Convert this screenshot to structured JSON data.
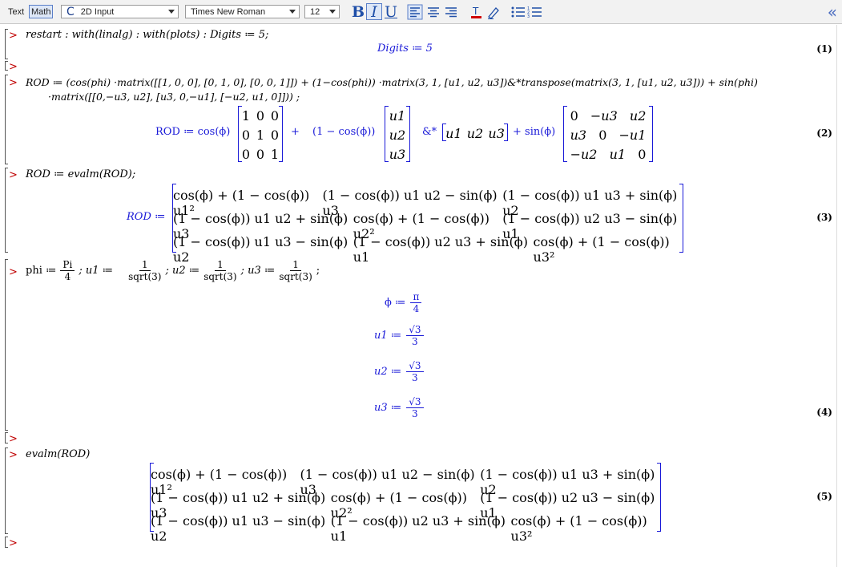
{
  "toolbar": {
    "text_mode": "Text",
    "math_mode": "Math",
    "input_mode": "2D Input",
    "font": "Times New Roman",
    "size": "12",
    "bold": "B",
    "italic": "I",
    "underline": "U"
  },
  "worksheet": {
    "in1": "restart : with(linalg) : with(plots) : Digits ≔ 5;",
    "out1": "Digits ≔ 5",
    "label1": "(1)",
    "in2_line1": "ROD ≔ (cos(phi) ·matrix([[1, 0, 0], [0, 1, 0], [0, 0, 1]]) + (1−cos(phi)) ·matrix(3, 1, [u1, u2, u3])&*transpose(matrix(3, 1, [u1, u2, u3])) + sin(phi)",
    "in2_line2": "·matrix([[0,−u3, u2], [u3, 0,−u1], [−u2, u1, 0]])) ;",
    "out2_lhs": "ROD ≔ cos(ϕ)",
    "out2_id": [
      [
        "1",
        "0",
        "0"
      ],
      [
        "0",
        "1",
        "0"
      ],
      [
        "0",
        "0",
        "1"
      ]
    ],
    "out2_plus1": "+",
    "out2_mid": "(1 − cos(ϕ))",
    "out2_u": [
      "u1",
      "u2",
      "u3"
    ],
    "out2_amp": "&*",
    "out2_ut": [
      "u1",
      "u2",
      "u3"
    ],
    "out2_plus2": "+ sin(ϕ)",
    "out2_skew": [
      [
        "0",
        "−u3",
        "u2"
      ],
      [
        "u3",
        "0",
        "−u1"
      ],
      [
        "−u2",
        "u1",
        "0"
      ]
    ],
    "label2": "(2)",
    "in3": "ROD ≔ evalm(ROD);",
    "out3_lhs": "ROD ≔",
    "rod_matrix": [
      [
        "cos(ϕ) + (1 − cos(ϕ)) u1²",
        "(1 − cos(ϕ)) u1 u2 − sin(ϕ) u3",
        "(1 − cos(ϕ)) u1 u3 + sin(ϕ) u2"
      ],
      [
        "(1 − cos(ϕ)) u1 u2 + sin(ϕ) u3",
        "cos(ϕ) + (1 − cos(ϕ)) u2²",
        "(1 − cos(ϕ)) u2 u3 − sin(ϕ) u1"
      ],
      [
        "(1 − cos(ϕ)) u1 u3 − sin(ϕ) u2",
        "(1 − cos(ϕ)) u2 u3 + sin(ϕ) u1",
        "cos(ϕ) + (1 − cos(ϕ)) u3²"
      ]
    ],
    "label3": "(3)",
    "in4_phi": "phi ≔",
    "in4_pi": "Pi",
    "in4_four": "4",
    "in4_u1": "; u1 ≔",
    "in4_u2": "; u2 ≔",
    "in4_u3": "; u3 ≔",
    "in4_one": "1",
    "in4_sqrt": "sqrt(3)",
    "in4_end": ";",
    "out4_phi": "ϕ ≔",
    "out4_pi": "π",
    "out4_four": "4",
    "out4_u1": "u1 ≔",
    "out4_u2": "u2 ≔",
    "out4_u3": "u3 ≔",
    "out4_sqrt3": "√3",
    "out4_three": "3",
    "label4": "(4)",
    "in5": "evalm(ROD)",
    "label5": "(5)"
  }
}
